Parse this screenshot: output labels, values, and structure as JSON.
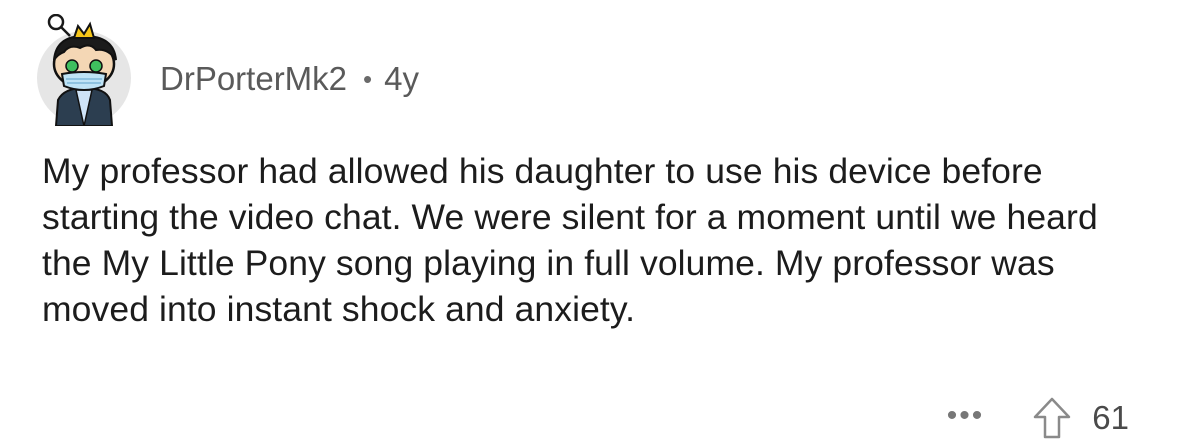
{
  "comment": {
    "username": "DrPorterMk2",
    "separator": "•",
    "age": "4y",
    "avatar_icon": "snoo-avatar-icon",
    "body": "My professor had allowed his daughter to use his device before starting the video chat. We were silent for a moment until we heard the My Little Pony song playing in full volume. My professor was moved into instant shock and anxiety.",
    "more_label": "•••",
    "upvote_icon": "upvote-arrow-icon",
    "score": "61"
  },
  "colors": {
    "background": "#ffffff",
    "text": "#1c1c1c",
    "meta_text": "#5a5a5a",
    "avatar_bg": "#e8e8e8",
    "crown": "#f5c518"
  }
}
